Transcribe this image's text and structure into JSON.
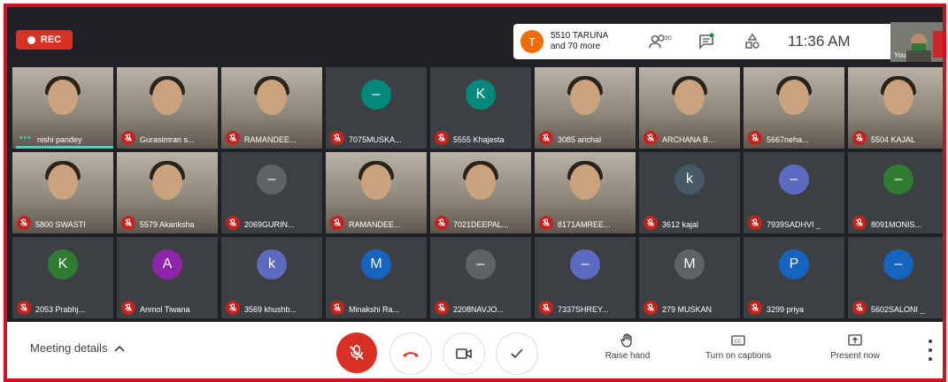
{
  "topbar": {
    "rec_label": "REC",
    "presenter": {
      "initial": "T",
      "name_line1": "5510 TARUNA",
      "name_line2": "and 70 more"
    },
    "people_count": "90",
    "clock": "11:36 AM",
    "self_label": "You"
  },
  "tiles": [
    {
      "name": "nishi pandey",
      "type": "video",
      "speaking": true
    },
    {
      "name": "Gurasimran s...",
      "type": "video"
    },
    {
      "name": "RAMANDEE...",
      "type": "video"
    },
    {
      "name": "7075MUSKA...",
      "type": "avatar",
      "initial": "–",
      "color": "#00897b"
    },
    {
      "name": "5555 Khajesta",
      "type": "avatar",
      "initial": "K",
      "color": "#00897b"
    },
    {
      "name": "3085 anchal",
      "type": "video"
    },
    {
      "name": "ARCHANA B...",
      "type": "video"
    },
    {
      "name": "5667neha...",
      "type": "video"
    },
    {
      "name": "5504 KAJAL",
      "type": "video"
    },
    {
      "name": "5800 SWASTI",
      "type": "video"
    },
    {
      "name": "5579 Akanksha",
      "type": "video"
    },
    {
      "name": "2069GURIN...",
      "type": "avatar",
      "initial": "–",
      "color": "#5f6368"
    },
    {
      "name": "RAMANDEE...",
      "type": "video"
    },
    {
      "name": "7021DEEPAL...",
      "type": "video"
    },
    {
      "name": "8171AMREE...",
      "type": "video"
    },
    {
      "name": "3612 kajal",
      "type": "avatar",
      "initial": "k",
      "color": "#455a64"
    },
    {
      "name": "7939SADHVI _",
      "type": "avatar",
      "initial": "–",
      "color": "#5c6bc0"
    },
    {
      "name": "8091MONIS...",
      "type": "avatar",
      "initial": "–",
      "color": "#2e7d32"
    },
    {
      "name": "2053 Prabhj...",
      "type": "avatar",
      "initial": "K",
      "color": "#2e7d32"
    },
    {
      "name": "Anmol Tiwana",
      "type": "avatar",
      "initial": "A",
      "color": "#8e24aa"
    },
    {
      "name": "3569 khushb...",
      "type": "avatar",
      "initial": "k",
      "color": "#5c6bc0"
    },
    {
      "name": "Minakshi Ra...",
      "type": "avatar",
      "initial": "M",
      "color": "#1565c0"
    },
    {
      "name": "2208NAVJO...",
      "type": "avatar",
      "initial": "–",
      "color": "#5f6368"
    },
    {
      "name": "7337SHREY...",
      "type": "avatar",
      "initial": "–",
      "color": "#5c6bc0"
    },
    {
      "name": "279 MUSKAN",
      "type": "avatar",
      "initial": "M",
      "color": "#5f6368"
    },
    {
      "name": "3299 priya",
      "type": "avatar",
      "initial": "P",
      "color": "#1565c0"
    },
    {
      "name": "5602SALONI _",
      "type": "avatar",
      "initial": "–",
      "color": "#1565c0"
    }
  ],
  "bottombar": {
    "meeting_details": "Meeting details",
    "raise_hand": "Raise hand",
    "captions": "Turn on captions",
    "present": "Present now"
  }
}
